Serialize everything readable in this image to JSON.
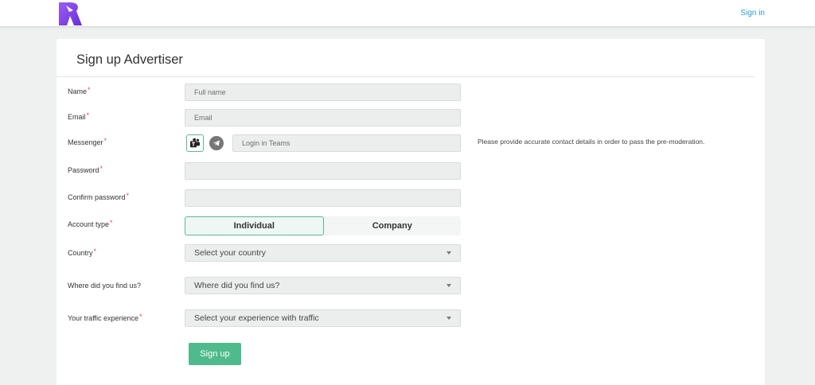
{
  "header": {
    "signin_label": "Sign in",
    "brand_color": "#7b3fe4"
  },
  "page": {
    "title": "Sign up Advertiser"
  },
  "form": {
    "name": {
      "label": "Name",
      "required_mark": "*",
      "placeholder": "Full name",
      "value": ""
    },
    "email": {
      "label": "Email",
      "required_mark": "*",
      "placeholder": "Email",
      "value": ""
    },
    "messenger": {
      "label": "Messenger",
      "required_mark": "*",
      "options": [
        "teams-icon",
        "telegram-icon"
      ],
      "selected": "teams-icon",
      "placeholder": "Login in Teams",
      "value": "",
      "hint": "Please provide accurate contact details in order to pass the pre-moderation."
    },
    "password": {
      "label": "Password",
      "required_mark": "*",
      "value": ""
    },
    "confirm_password": {
      "label": "Confirm password",
      "required_mark": "*",
      "value": ""
    },
    "account_type": {
      "label": "Account type",
      "required_mark": "*",
      "options": [
        "Individual",
        "Company"
      ],
      "selected": "Individual"
    },
    "country": {
      "label": "Country",
      "required_mark": "*",
      "selected": "Select your country"
    },
    "source": {
      "label": "Where did you find us?",
      "selected": "Where did you find us?"
    },
    "traffic": {
      "label": "Your traffic experience",
      "required_mark": "*",
      "selected": "Select your experience with traffic"
    },
    "submit_label": "Sign up"
  },
  "colors": {
    "accent": "#4fba8c",
    "link": "#2a9fd6",
    "required": "#d9534f"
  }
}
